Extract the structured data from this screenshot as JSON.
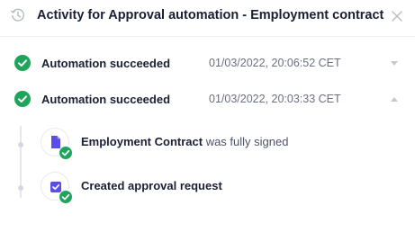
{
  "header": {
    "title": "Activity for Approval automation - Employment contract",
    "icon": "history-icon",
    "close_icon": "close-icon"
  },
  "activities": [
    {
      "label": "Automation succeeded",
      "timestamp": "01/03/2022, 20:06:52 CET",
      "expanded": false
    },
    {
      "label": "Automation succeeded",
      "timestamp": "01/03/2022, 20:03:33 CET",
      "expanded": true
    }
  ],
  "events": [
    {
      "subject": "Employment Contract",
      "text": " was fully signed",
      "icon": "document-icon"
    },
    {
      "subject": "",
      "text": "Created approval request",
      "icon": "checkbox-icon"
    }
  ],
  "colors": {
    "success": "#1fa55b",
    "accent": "#5b4ee8",
    "text": "#1b1f33",
    "muted": "#6b7085"
  }
}
